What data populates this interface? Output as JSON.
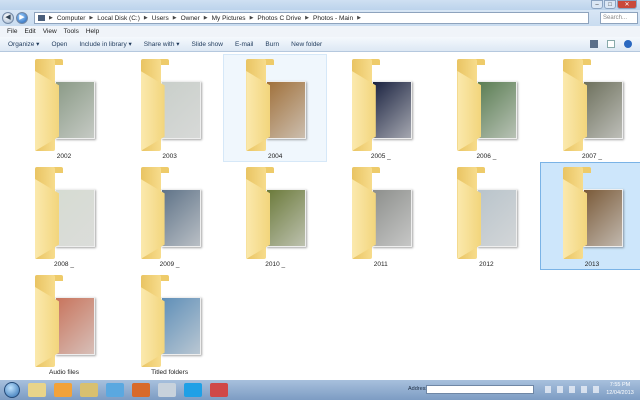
{
  "window": {
    "minimize": "–",
    "maximize": "□",
    "close": "✕"
  },
  "address": {
    "crumbs": [
      "Computer",
      "Local Disk (C:)",
      "Users",
      "Owner",
      "My Pictures",
      "Photos C Drive",
      "Photos - Main"
    ],
    "search_placeholder": "Search..."
  },
  "menu": [
    "File",
    "Edit",
    "View",
    "Tools",
    "Help"
  ],
  "toolbar": [
    "Organize ▾",
    "Open",
    "Include in library ▾",
    "Share with ▾",
    "Slide show",
    "E-mail",
    "Burn",
    "New folder"
  ],
  "folders": [
    {
      "name": "2002",
      "photo": "#8a9a86",
      "state": "normal"
    },
    {
      "name": "2003",
      "photo": "#c9cfca",
      "state": "normal"
    },
    {
      "name": "2004",
      "photo": "#a0703a",
      "state": "hover"
    },
    {
      "name": "2005 _",
      "photo": "#1a2240",
      "state": "normal"
    },
    {
      "name": "2006 _",
      "photo": "#5a7d52",
      "state": "normal"
    },
    {
      "name": "2007 _",
      "photo": "#6d705c",
      "state": "normal"
    },
    {
      "name": "2008 _",
      "photo": "#d6dcd2",
      "state": "normal"
    },
    {
      "name": "2009 _",
      "photo": "#5f7388",
      "state": "normal"
    },
    {
      "name": "2010 _",
      "photo": "#6b7a3a",
      "state": "normal"
    },
    {
      "name": "2011",
      "photo": "#8d8f8c",
      "state": "normal"
    },
    {
      "name": "2012",
      "photo": "#b9c4cb",
      "state": "normal"
    },
    {
      "name": "2013",
      "photo": "#7a5a38",
      "state": "selected"
    },
    {
      "name": "Audio files",
      "photo": "#c8745c",
      "state": "normal"
    },
    {
      "name": "Titled folders",
      "photo": "#5f8fb8",
      "state": "normal"
    }
  ],
  "taskbar": {
    "address_label": "Address",
    "time": "7:55 PM",
    "date": "12/04/2013",
    "apps": [
      {
        "name": "explorer",
        "color": "#e8d48a"
      },
      {
        "name": "media-player",
        "color": "#f2a23a"
      },
      {
        "name": "folders",
        "color": "#d8c070"
      },
      {
        "name": "internet-explorer",
        "color": "#5aa8e0"
      },
      {
        "name": "firefox",
        "color": "#d86a2a"
      },
      {
        "name": "calculator",
        "color": "#c8d2dc"
      },
      {
        "name": "skype",
        "color": "#1fa0e6"
      },
      {
        "name": "app",
        "color": "#d04848"
      }
    ]
  }
}
